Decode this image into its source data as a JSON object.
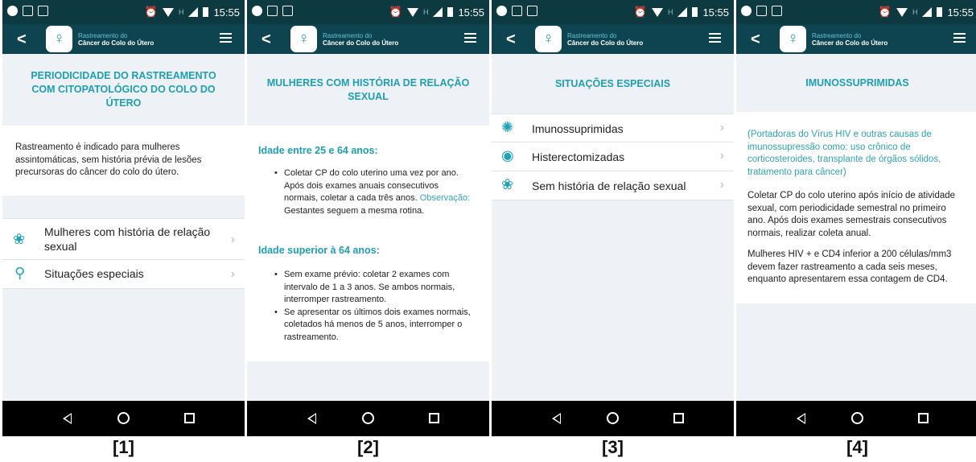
{
  "status": {
    "time": "15:55",
    "network": "H"
  },
  "app": {
    "title_line1": "Rastreamento do",
    "title_line2": "Câncer do Colo do Útero",
    "logo_icon": "uterus-logo-icon"
  },
  "screen1": {
    "heading": "PERIODICIDADE DO RASTREAMENTO COM CITOPATOLÓGICO DO COLO DO ÚTERO",
    "intro": "Rastreamento é indicado para mulheres assintomáticas, sem história prévia de lesões precursoras do câncer do colo do útero.",
    "items": [
      {
        "label": "Mulheres com história de relação sexual",
        "icon": "lotus-icon"
      },
      {
        "label": "Situações especiais",
        "icon": "female-symbol-icon"
      }
    ]
  },
  "screen2": {
    "heading": "MULHERES COM HISTÓRIA DE RELAÇÃO SEXUAL",
    "section1_title": "Idade entre 25 e 64 anos:",
    "section1_bullet": "Coletar CP do colo uterino uma vez por ano. Após dois exames anuais consecutivos normais, coletar a cada três anos.",
    "section1_obs_label": "Observação:",
    "section1_obs_text": " Gestantes seguem a mesma rotina.",
    "section2_title": "Idade superior à 64 anos:",
    "section2_bullets": [
      "Sem exame prévio: coletar 2 exames com intervalo de 1 a 3 anos. Se ambos normais, interromper rastreamento.",
      "Se apresentar os últimos dois exames normais, coletados há menos de 5 anos, interromper o rastreamento."
    ]
  },
  "screen3": {
    "heading": "SITUAÇÕES ESPECIAIS",
    "items": [
      {
        "label": "Imunossuprimidas",
        "icon": "virus-icon"
      },
      {
        "label": "Histerectomizadas",
        "icon": "uterus-circle-icon"
      },
      {
        "label": "Sem história de relação sexual",
        "icon": "lotus-icon"
      }
    ]
  },
  "screen4": {
    "heading": "IMUNOSSUPRIMIDAS",
    "note": "(Portadoras do Vírus HIV e outras causas de imunossupressão como: uso crônico de corticosteroides, transplante de órgãos sólidos, tratamento para câncer)",
    "para1": "Coletar CP do colo uterino após início de atividade sexual, com periodicidade semestral no primeiro ano. Após dois exames semestrais consecutivos normais, realizar coleta anual.",
    "para2": "Mulheres HIV + e CD4 inferior a 200 células/mm3 devem fazer rastreamento a cada seis meses, enquanto apresentarem essa contagem de CD4."
  },
  "captions": [
    "[1]",
    "[2]",
    "[3]",
    "[4]"
  ],
  "colors": {
    "accent": "#1e9fb4",
    "appbar": "#0e4450",
    "statusbar": "#0d3a40",
    "background": "#eef2f7"
  }
}
